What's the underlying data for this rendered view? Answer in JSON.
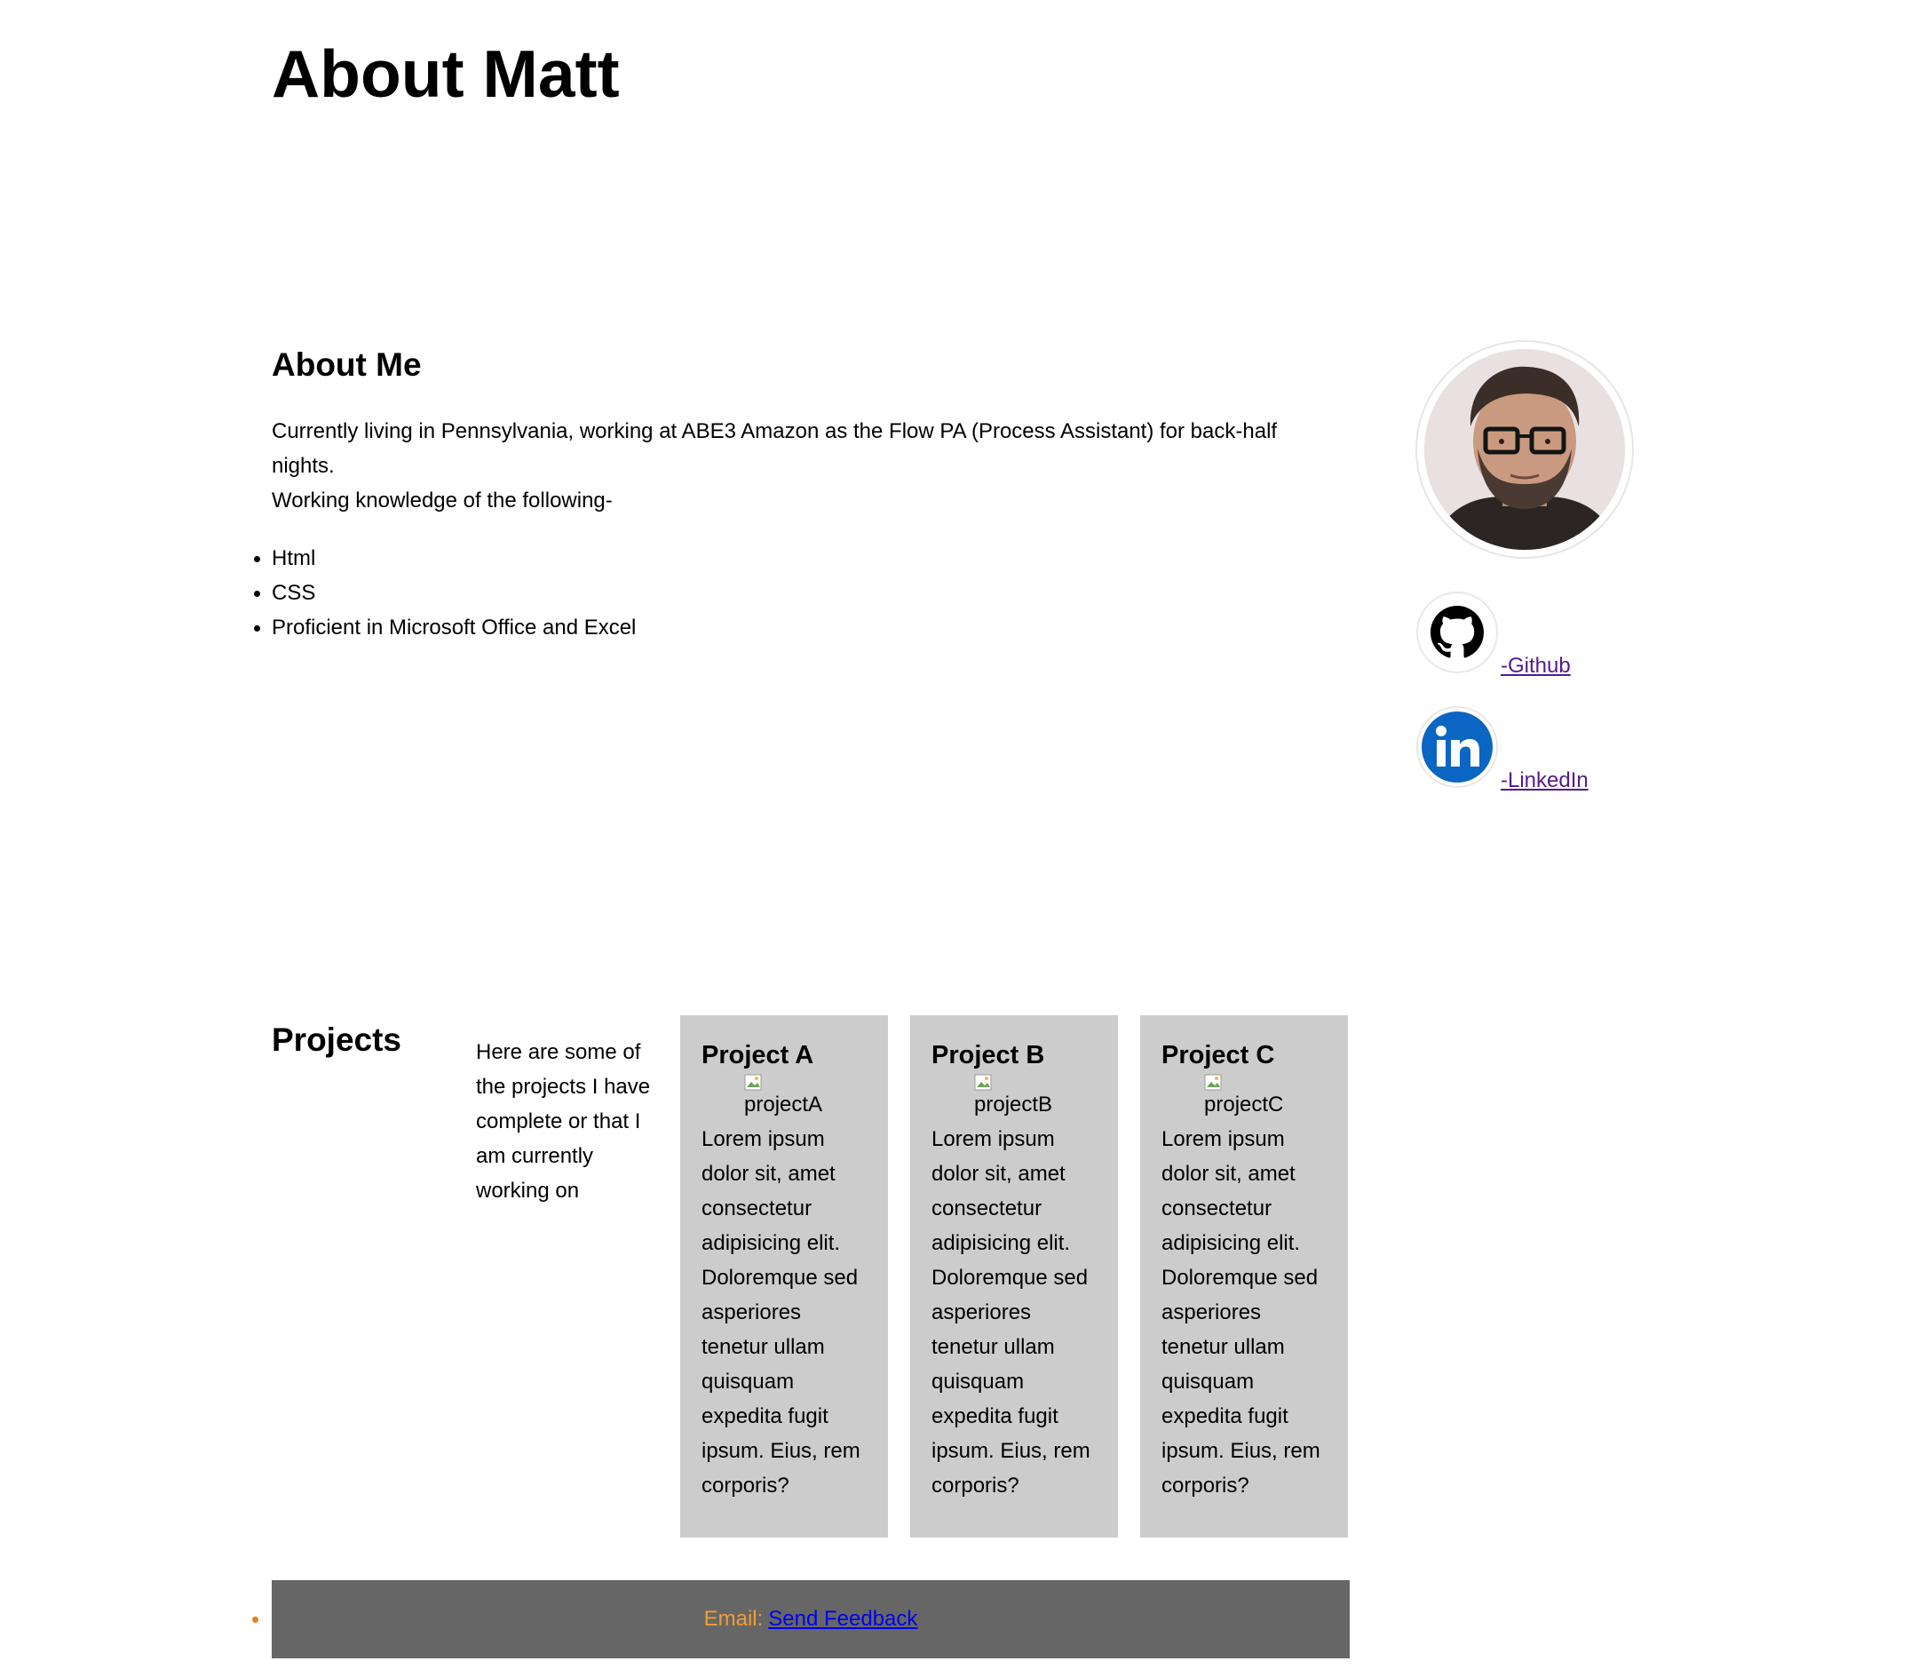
{
  "page": {
    "title": "About Matt"
  },
  "about": {
    "heading": "About Me",
    "line1": "Currently living in Pennsylvania, working at ABE3 Amazon as the Flow PA (Process Assistant) for back-half nights.",
    "line2": "Working knowledge of the following-",
    "skills": [
      "Html",
      "CSS",
      "Proficient in Microsoft Office and Excel"
    ]
  },
  "sidebar": {
    "photo_alt": "profile photo",
    "github": {
      "label": "-Github",
      "icon": "github-icon"
    },
    "linkedin": {
      "label": "-LinkedIn",
      "icon": "linkedin-icon"
    }
  },
  "projects": {
    "heading": "Projects",
    "intro": "Here are some of the projects I have complete or that I am currently working on",
    "items": [
      {
        "title": "Project A",
        "image_alt": "projectA",
        "description": "Lorem ipsum dolor sit, amet consectetur adipisicing elit. Doloremque sed asperiores tenetur ullam quisquam expedita fugit ipsum. Eius, rem corporis?"
      },
      {
        "title": "Project B",
        "image_alt": "projectB",
        "description": "Lorem ipsum dolor sit, amet consectetur adipisicing elit. Doloremque sed asperiores tenetur ullam quisquam expedita fugit ipsum. Eius, rem corporis?"
      },
      {
        "title": "Project C",
        "image_alt": "projectC",
        "description": "Lorem ipsum dolor sit, amet consectetur adipisicing elit. Doloremque sed asperiores tenetur ullam quisquam expedita fugit ipsum. Eius, rem corporis?"
      }
    ]
  },
  "footer": {
    "email_label": "Email:",
    "link_label": "Send Feedback"
  },
  "colors": {
    "card_bg": "#cccccc",
    "footer_bg": "#666666",
    "footer_label": "#f39c34",
    "visited_link": "#551a8b",
    "link": "#0000ee",
    "linkedin_blue": "#0a66c2"
  }
}
